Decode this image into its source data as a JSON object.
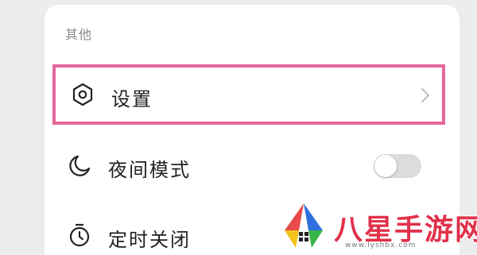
{
  "section": {
    "title": "其他"
  },
  "menu": {
    "items": [
      {
        "label": "设置",
        "icon": "hexagon-settings-icon",
        "trailing": "chevron-right-icon",
        "highlighted": true
      },
      {
        "label": "夜间模式",
        "icon": "moon-icon",
        "trailing": "toggle",
        "toggle_on": false
      },
      {
        "label": "定时关闭",
        "icon": "timer-icon"
      }
    ]
  },
  "colors": {
    "highlight_border": "#e5679a",
    "watermark_red": "#e0324a",
    "toggle_off": "#dcdcdc"
  },
  "watermark": {
    "text": "八星手游网",
    "url": "www.lyshbx.com"
  }
}
